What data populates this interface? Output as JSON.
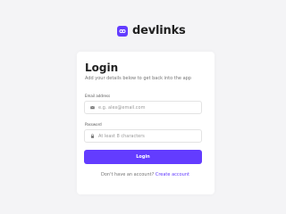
{
  "brand": {
    "name": "devlinks",
    "accent_color": "#633cff",
    "icon": "link-logo-icon"
  },
  "login_form": {
    "title": "Login",
    "subtitle": "Add your details below to get back into the app",
    "email": {
      "label": "Email address",
      "placeholder": "e.g. alex@email.com",
      "value": "",
      "icon": "envelope-icon"
    },
    "password": {
      "label": "Password",
      "placeholder": "At least 8 characters",
      "value": "",
      "icon": "lock-icon"
    },
    "submit_label": "Login",
    "footer_text": "Don't have an account?",
    "create_account_link": "Create account"
  }
}
